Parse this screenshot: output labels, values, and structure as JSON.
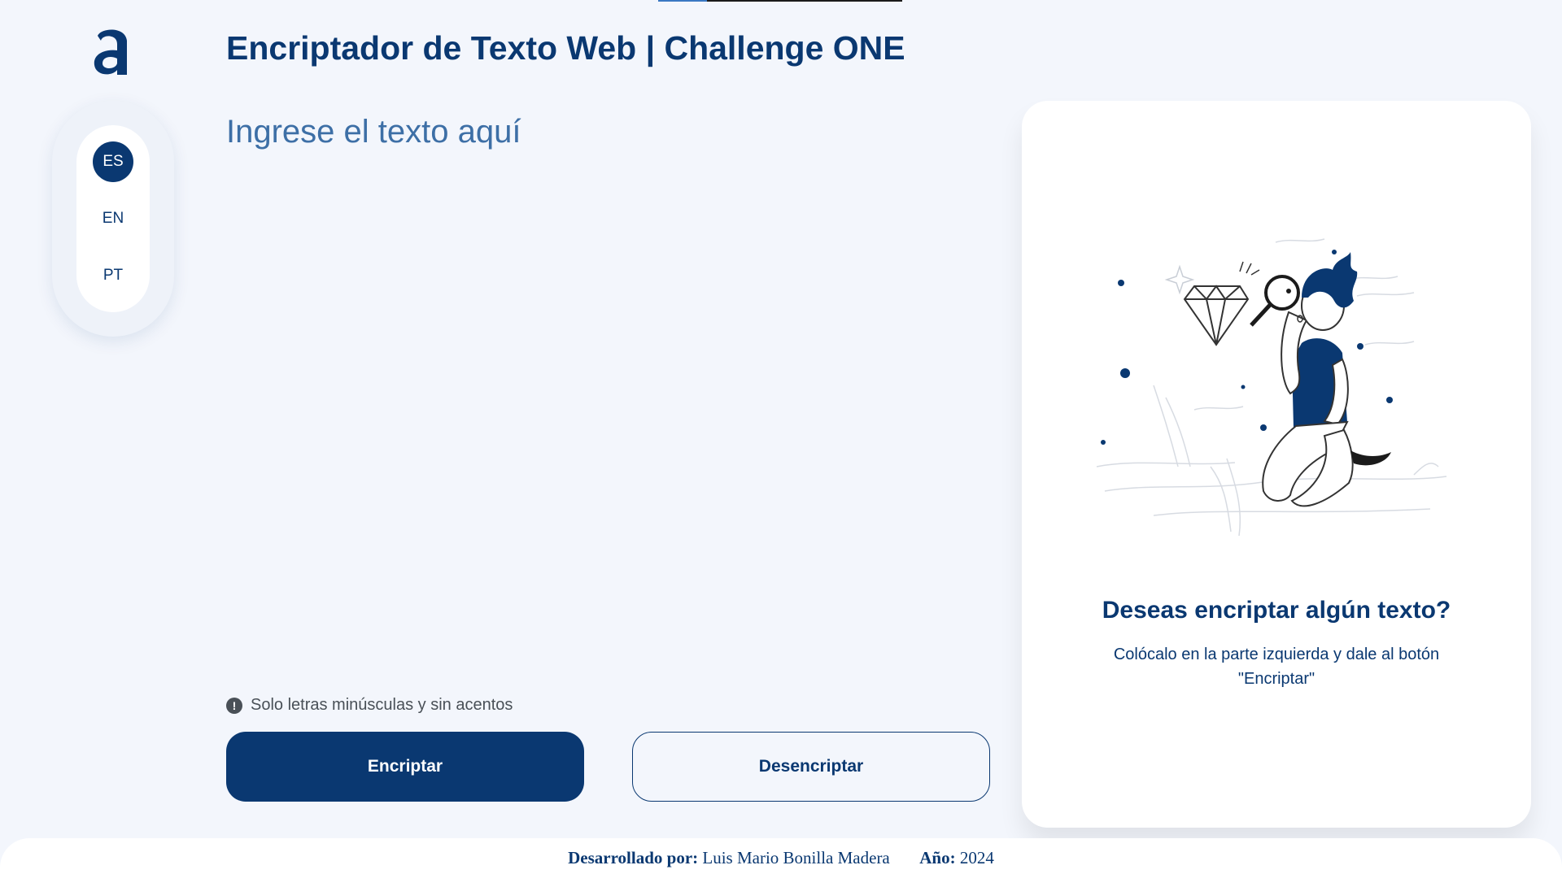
{
  "header": {
    "title": "Encriptador de Texto Web | Challenge ONE",
    "logo_icon": "alura-logo-icon"
  },
  "languages": [
    {
      "label": "ES",
      "active": true
    },
    {
      "label": "EN",
      "active": false
    },
    {
      "label": "PT",
      "active": false
    }
  ],
  "input": {
    "placeholder": "Ingrese el texto aquí",
    "value": ""
  },
  "hint": {
    "icon": "exclamation-circle-icon",
    "text": "Solo letras minúsculas y sin acentos"
  },
  "buttons": {
    "encrypt_label": "Encriptar",
    "decrypt_label": "Desencriptar"
  },
  "output_card": {
    "illustration": "person-with-magnifier-illustration",
    "title": "Deseas encriptar algún texto?",
    "text": "Colócalo en la parte izquierda y dale al botón \"Encriptar\""
  },
  "footer": {
    "developed_by_label": "Desarrollado por:",
    "developer": "Luis Mario Bonilla Madera",
    "year_label": "Año:",
    "year": "2024"
  },
  "colors": {
    "primary": "#0a3871",
    "background": "#f3f6fc",
    "card": "#ffffff",
    "muted": "#495057"
  }
}
